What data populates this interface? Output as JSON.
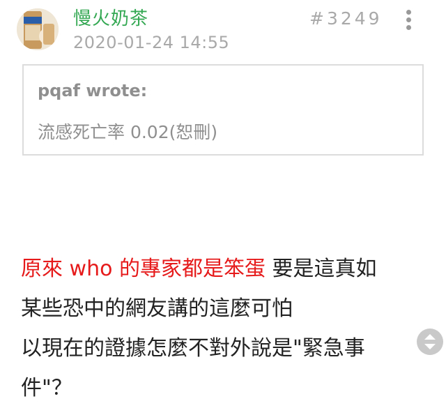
{
  "post": {
    "username": "慢火奶茶",
    "timestamp": "2020-01-24 14:55",
    "post_number": "#3249",
    "avatar_icon": "nestle-milk-tea-can-avatar",
    "quote": {
      "author": "pqaf wrote:",
      "text": "流感死亡率 0.02(恕刪)"
    },
    "body": {
      "highlight": "原來 who 的專家都是笨蛋",
      "line1_rest": " 要是這真如",
      "line2": "某些恐中的網友講的這麼可怕",
      "line3": "以現在的證據怎麼不對外說是\"緊急事",
      "line4": "件\"？"
    }
  },
  "colors": {
    "username": "#34a853",
    "highlight": "#e61a1a",
    "meta": "#a9a9a9"
  }
}
